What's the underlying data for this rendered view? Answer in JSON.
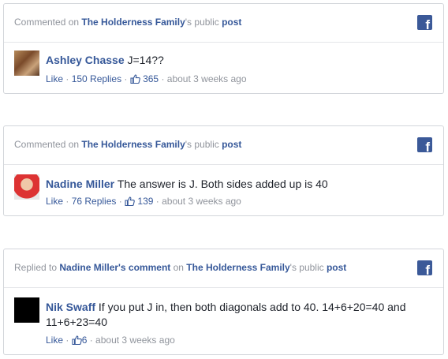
{
  "cards": [
    {
      "header": {
        "prefix": "Commented on ",
        "page": "The Holderness Family",
        "middle": "'s public ",
        "post": "post"
      },
      "author": "Ashley Chasse",
      "text": "J=14??",
      "like": "Like",
      "replies": "150 Replies",
      "likes_count": "365",
      "time": "about 3 weeks ago"
    },
    {
      "header": {
        "prefix": "Commented on ",
        "page": "The Holderness Family",
        "middle": "'s public ",
        "post": "post"
      },
      "author": "Nadine Miller",
      "text": "The answer is J. Both sides added up is 40",
      "like": "Like",
      "replies": "76 Replies",
      "likes_count": "139",
      "time": "about 3 weeks ago"
    },
    {
      "header": {
        "prefix": "Replied to ",
        "target": "Nadine Miller's comment",
        "on": " on ",
        "page": "The Holderness Family",
        "middle": "'s public ",
        "post": "post"
      },
      "author": "Nik Swaff",
      "text": "If you put J in, then both diagonals add to 40. 14+6+20=40 and 11+6+23=40",
      "like": "Like",
      "likes_count": "6",
      "time": "about 3 weeks ago"
    }
  ],
  "fb_glyph": "f",
  "separator": " · ",
  "colors": {
    "link": "#365899",
    "meta": "#90949c",
    "fb_blue": "#3b5998",
    "border": "#d3d6db"
  }
}
